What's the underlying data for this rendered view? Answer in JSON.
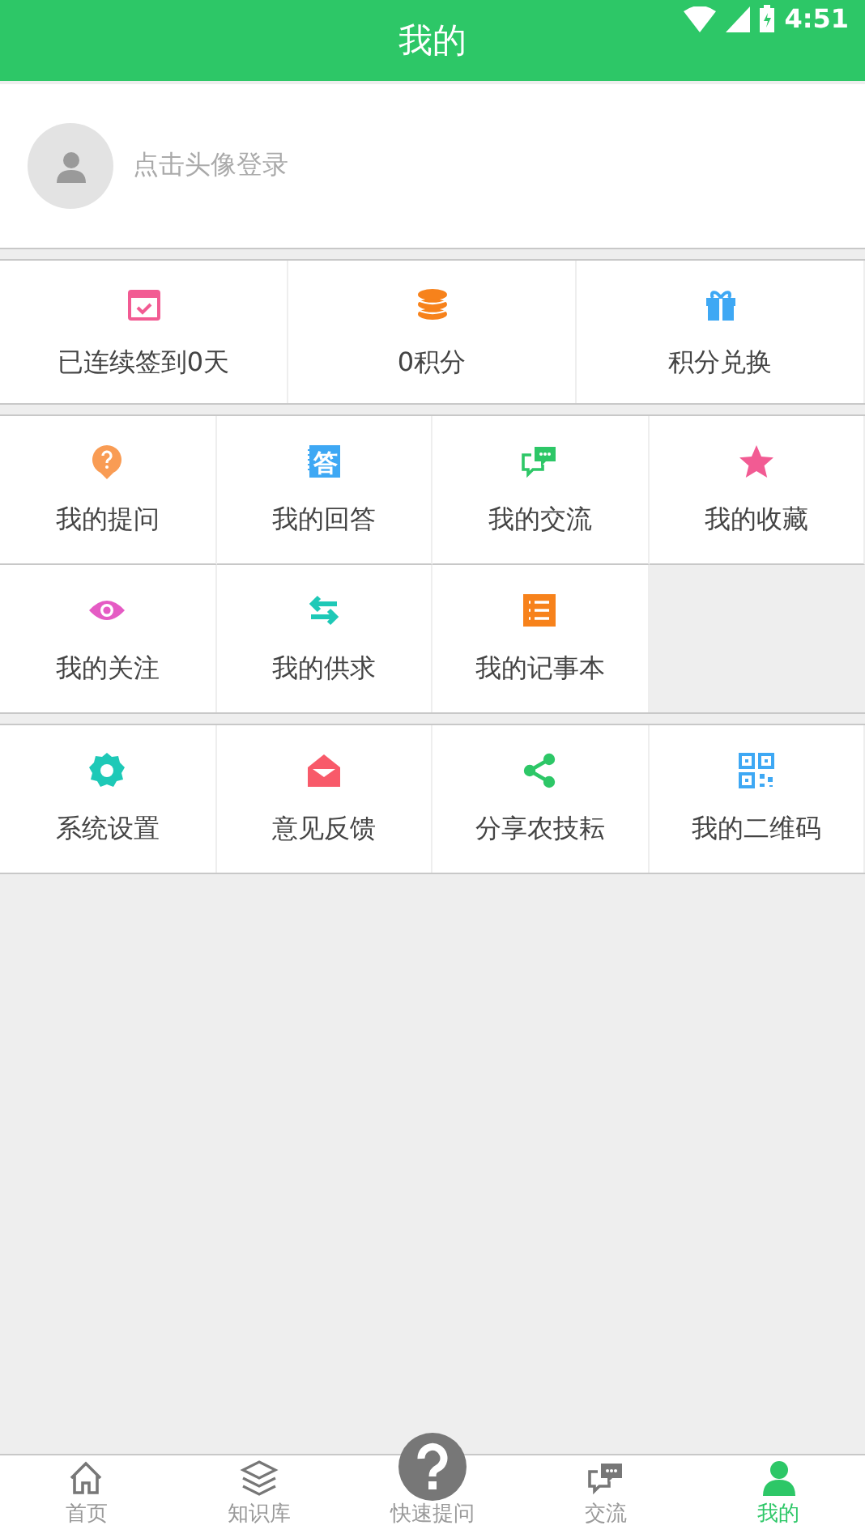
{
  "status_bar": {
    "time": "4:51"
  },
  "header": {
    "title": "我的"
  },
  "profile": {
    "prompt": "点击头像登录"
  },
  "points": [
    {
      "label": "已连续签到0天"
    },
    {
      "label": "0积分"
    },
    {
      "label": "积分兑换"
    }
  ],
  "sections": [
    [
      {
        "label": "我的提问"
      },
      {
        "label": "我的回答",
        "glyph": "答"
      },
      {
        "label": "我的交流"
      },
      {
        "label": "我的收藏"
      },
      {
        "label": "我的关注"
      },
      {
        "label": "我的供求"
      },
      {
        "label": "我的记事本"
      }
    ],
    [
      {
        "label": "系统设置"
      },
      {
        "label": "意见反馈"
      },
      {
        "label": "分享农技耘"
      },
      {
        "label": "我的二维码"
      }
    ]
  ],
  "bottom_nav": [
    {
      "kind": "plain",
      "label": "首页",
      "selected": false
    },
    {
      "kind": "plain",
      "label": "知识库",
      "selected": false
    },
    {
      "kind": "raised",
      "label": "快速提问",
      "selected": false
    },
    {
      "kind": "plain",
      "label": "交流",
      "selected": false
    },
    {
      "kind": "plain",
      "label": "我的",
      "selected": true
    }
  ]
}
